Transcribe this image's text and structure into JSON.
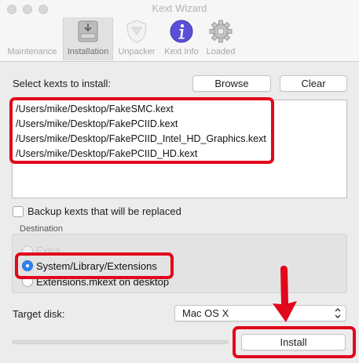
{
  "window": {
    "title": "Kext Wizard"
  },
  "toolbar": {
    "tabs": [
      {
        "label": "Maintenance",
        "icon": "maintenance-icon"
      },
      {
        "label": "Installation",
        "icon": "installation-drive-icon",
        "active": true
      },
      {
        "label": "Unpacker",
        "icon": "unpacker-shield-icon"
      },
      {
        "label": "Kext Info",
        "icon": "info-icon"
      },
      {
        "label": "Loaded",
        "icon": "gear-icon"
      }
    ]
  },
  "install": {
    "select_label": "Select kexts to install:",
    "browse_label": "Browse",
    "clear_label": "Clear",
    "kexts": [
      "/Users/mike/Desktop/FakeSMC.kext",
      "/Users/mike/Desktop/FakePCIID.kext",
      "/Users/mike/Desktop/FakePCIID_Intel_HD_Graphics.kext",
      "/Users/mike/Desktop/FakePCIID_HD.kext"
    ],
    "backup_label": "Backup kexts that will be replaced",
    "backup_checked": false,
    "destination_title": "Destination",
    "destination_options": [
      {
        "label": "Extra",
        "selected": false,
        "enabled": false
      },
      {
        "label": "System/Library/Extensions",
        "selected": true,
        "enabled": true
      },
      {
        "label": "Extensions.mkext on desktop",
        "selected": false,
        "enabled": true
      }
    ],
    "target_disk_label": "Target disk:",
    "target_disk_value": "Mac OS X",
    "install_label": "Install",
    "progress": 0
  },
  "colors": {
    "highlight_red": "#e1081b",
    "accent_blue": "#2f81f4",
    "window_bg": "#ececec"
  }
}
